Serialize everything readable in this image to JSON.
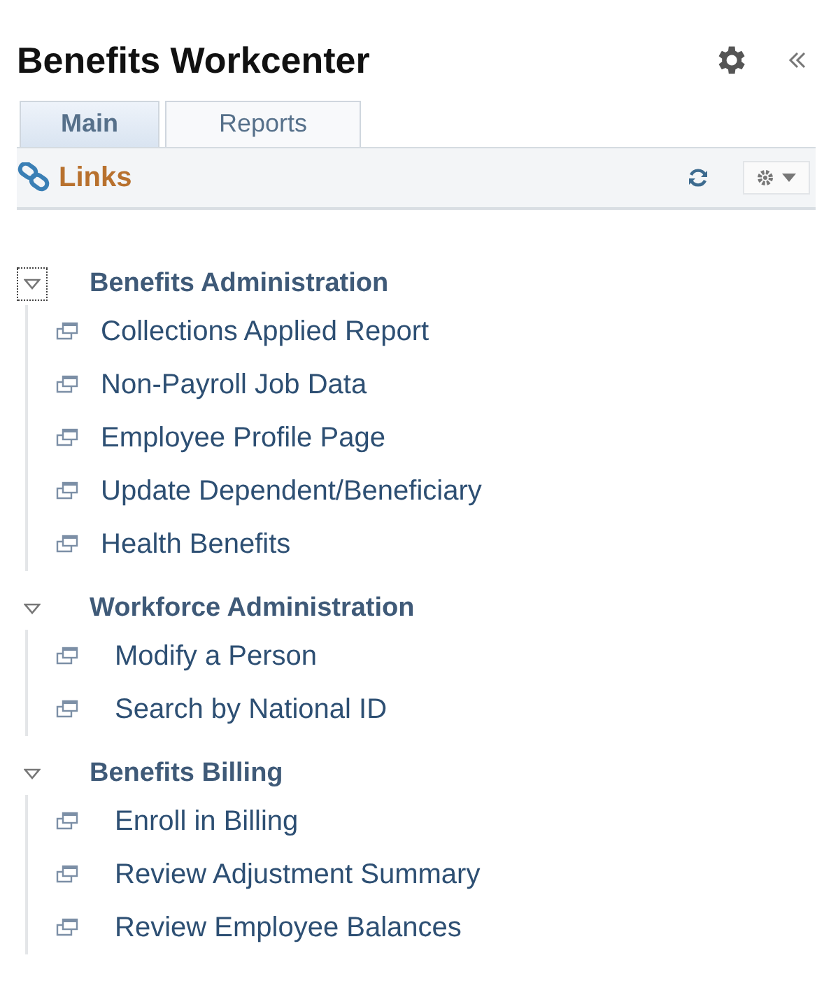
{
  "header": {
    "title": "Benefits Workcenter"
  },
  "tabs": [
    {
      "label": "Main",
      "selected": true
    },
    {
      "label": "Reports",
      "selected": false
    }
  ],
  "pagelet": {
    "title": "Links"
  },
  "groups": [
    {
      "title": "Benefits Administration",
      "expanded": true,
      "focused": true,
      "items": [
        "Collections Applied Report",
        "Non-Payroll Job Data",
        "Employee Profile Page",
        "Update Dependent/Beneficiary",
        "Health Benefits"
      ]
    },
    {
      "title": "Workforce Administration",
      "expanded": true,
      "focused": false,
      "items": [
        "Modify a Person",
        "Search by National ID"
      ]
    },
    {
      "title": "Benefits Billing",
      "expanded": true,
      "focused": false,
      "items": [
        "Enroll in Billing",
        "Review Adjustment Summary",
        "Review Employee Balances"
      ]
    }
  ]
}
